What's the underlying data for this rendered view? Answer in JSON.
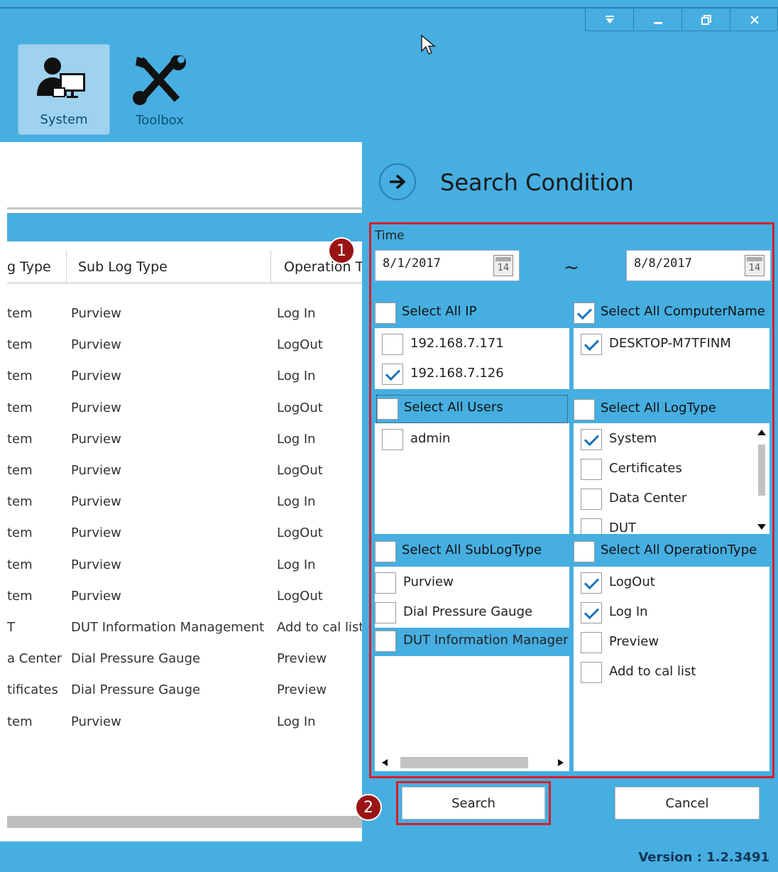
{
  "window_controls": [
    "dropdown",
    "minimize",
    "restore",
    "close"
  ],
  "toolbar": {
    "system_label": "System",
    "toolbox_label": "Toolbox"
  },
  "grid": {
    "headers": [
      "g Type",
      "Sub Log Type",
      "Operation T"
    ],
    "rows": [
      [
        "tem",
        "Purview",
        "Log In"
      ],
      [
        "tem",
        "Purview",
        "LogOut"
      ],
      [
        "tem",
        "Purview",
        "Log In"
      ],
      [
        "tem",
        "Purview",
        "LogOut"
      ],
      [
        "tem",
        "Purview",
        "Log In"
      ],
      [
        "tem",
        "Purview",
        "LogOut"
      ],
      [
        "tem",
        "Purview",
        "Log In"
      ],
      [
        "tem",
        "Purview",
        "LogOut"
      ],
      [
        "tem",
        "Purview",
        "Log In"
      ],
      [
        "tem",
        "Purview",
        "LogOut"
      ],
      [
        "T",
        "DUT Information Management",
        "Add to cal list"
      ],
      [
        "a Center",
        "Dial Pressure Gauge",
        "Preview"
      ],
      [
        "tificates",
        "Dial Pressure Gauge",
        "Preview"
      ],
      [
        "tem",
        "Purview",
        "Log In"
      ]
    ]
  },
  "search_panel": {
    "title": "Search Condition",
    "time_label": "Time",
    "date_from": "8/1/2017",
    "date_to": "8/8/2017",
    "calendar_day": "14",
    "range_sep": "~",
    "ip": {
      "header": "Select All IP",
      "checked": false,
      "items": [
        {
          "label": "192.168.7.171",
          "checked": false
        },
        {
          "label": "192.168.7.126",
          "checked": true
        }
      ]
    },
    "computer": {
      "header": "Select All ComputerName",
      "checked": true,
      "items": [
        {
          "label": "DESKTOP-M7TFINM",
          "checked": true
        }
      ]
    },
    "users": {
      "header": "Select All Users",
      "checked": false,
      "items": [
        {
          "label": "admin",
          "checked": false
        }
      ]
    },
    "logtype": {
      "header": "Select All LogType",
      "checked": false,
      "items": [
        {
          "label": "System",
          "checked": true
        },
        {
          "label": "Certificates",
          "checked": false
        },
        {
          "label": "Data Center",
          "checked": false
        },
        {
          "label": "DUT",
          "checked": false
        }
      ]
    },
    "sublogtype": {
      "header": "Select All SubLogType",
      "checked": false,
      "items": [
        {
          "label": "Purview",
          "checked": false
        },
        {
          "label": "Dial Pressure Gauge",
          "checked": false
        },
        {
          "label": "DUT Information Manager",
          "checked": false
        }
      ]
    },
    "optype": {
      "header": "Select All OperationType",
      "checked": false,
      "items": [
        {
          "label": "LogOut",
          "checked": true
        },
        {
          "label": "Log In",
          "checked": true
        },
        {
          "label": "Preview",
          "checked": false
        },
        {
          "label": "Add to cal list",
          "checked": false
        }
      ]
    },
    "search_label": "Search",
    "cancel_label": "Cancel"
  },
  "badges": [
    "1",
    "2"
  ],
  "footer": {
    "version": "Version : 1.2.3491"
  },
  "colors": {
    "accent": "#46aee0",
    "highlight": "#d81e2a",
    "badge": "#9b1414"
  }
}
